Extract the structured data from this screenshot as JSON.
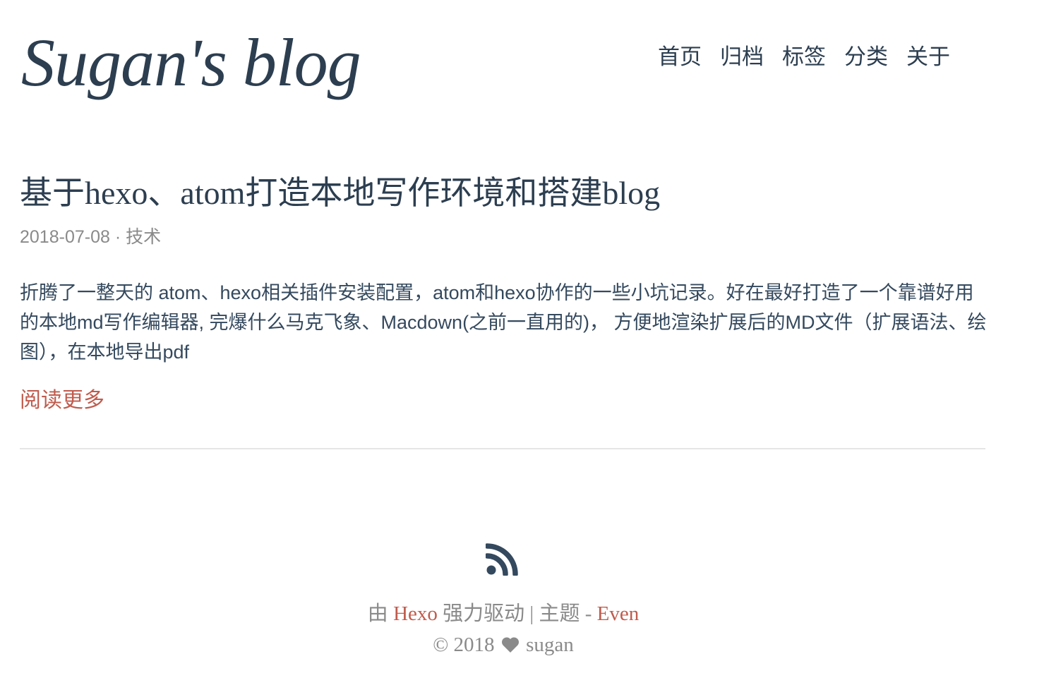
{
  "header": {
    "logo": "Sugan's blog",
    "nav": [
      {
        "label": "首页"
      },
      {
        "label": "归档"
      },
      {
        "label": "标签"
      },
      {
        "label": "分类"
      },
      {
        "label": "关于"
      }
    ]
  },
  "post": {
    "title": "基于hexo、atom打造本地写作环境和搭建blog",
    "date": "2018-07-08",
    "meta_separator": "·",
    "category": "技术",
    "summary": "折腾了一整天的 atom、hexo相关插件安装配置，atom和hexo协作的一些小坑记录。好在最好打造了一个靠谱好用的本地md写作编辑器, 完爆什么马克飞象、Macdown(之前一直用的)， 方便地渲染扩展后的MD文件（扩展语法、绘图），在本地导出pdf",
    "read_more": "阅读更多"
  },
  "footer": {
    "rss_icon": "rss-icon",
    "powered_prefix": "由",
    "powered_link": "Hexo",
    "powered_suffix": "强力驱动 | 主题 -",
    "theme_link": "Even",
    "copyright": "© 2018",
    "heart_icon": "heart-icon",
    "author": "sugan"
  },
  "colors": {
    "text": "#2c3e50",
    "accent": "#c05b4d",
    "muted": "#8a8a8a",
    "divider": "#e6e6e6"
  }
}
